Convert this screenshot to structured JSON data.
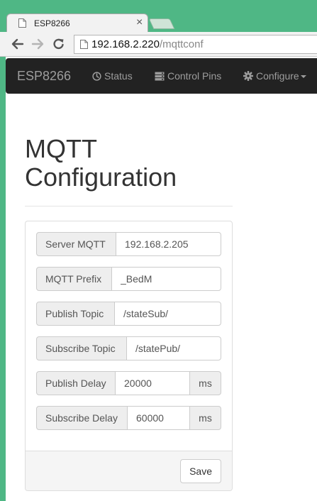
{
  "browser": {
    "tab_title": "ESP8266",
    "url_host": "192.168.2.220",
    "url_path": "/mqttconf",
    "tab_close": "×"
  },
  "navbar": {
    "brand": "ESP8266",
    "items": [
      {
        "label": "Status",
        "icon": "dashboard-icon"
      },
      {
        "label": "Control Pins",
        "icon": "server-icon"
      },
      {
        "label": "Configure",
        "icon": "gear-icon",
        "dropdown": true
      }
    ]
  },
  "page": {
    "title_line1": "MQTT",
    "title_line2": "Configuration"
  },
  "form": {
    "fields": [
      {
        "label": "Server MQTT",
        "value": "192.168.2.205"
      },
      {
        "label": "MQTT Prefix",
        "value": "_BedM"
      },
      {
        "label": "Publish Topic",
        "value": "/stateSub/"
      },
      {
        "label": "Subscribe Topic",
        "value": "/statePub/"
      },
      {
        "label": "Publish Delay",
        "value": "20000",
        "unit": "ms"
      },
      {
        "label": "Subscribe Delay",
        "value": "60000",
        "unit": "ms"
      }
    ],
    "save_label": "Save"
  },
  "colors": {
    "window_frame": "#4fb785",
    "navbar_bg": "#222222",
    "navbar_text": "#9d9d9d",
    "addon_bg": "#eeeeee"
  }
}
